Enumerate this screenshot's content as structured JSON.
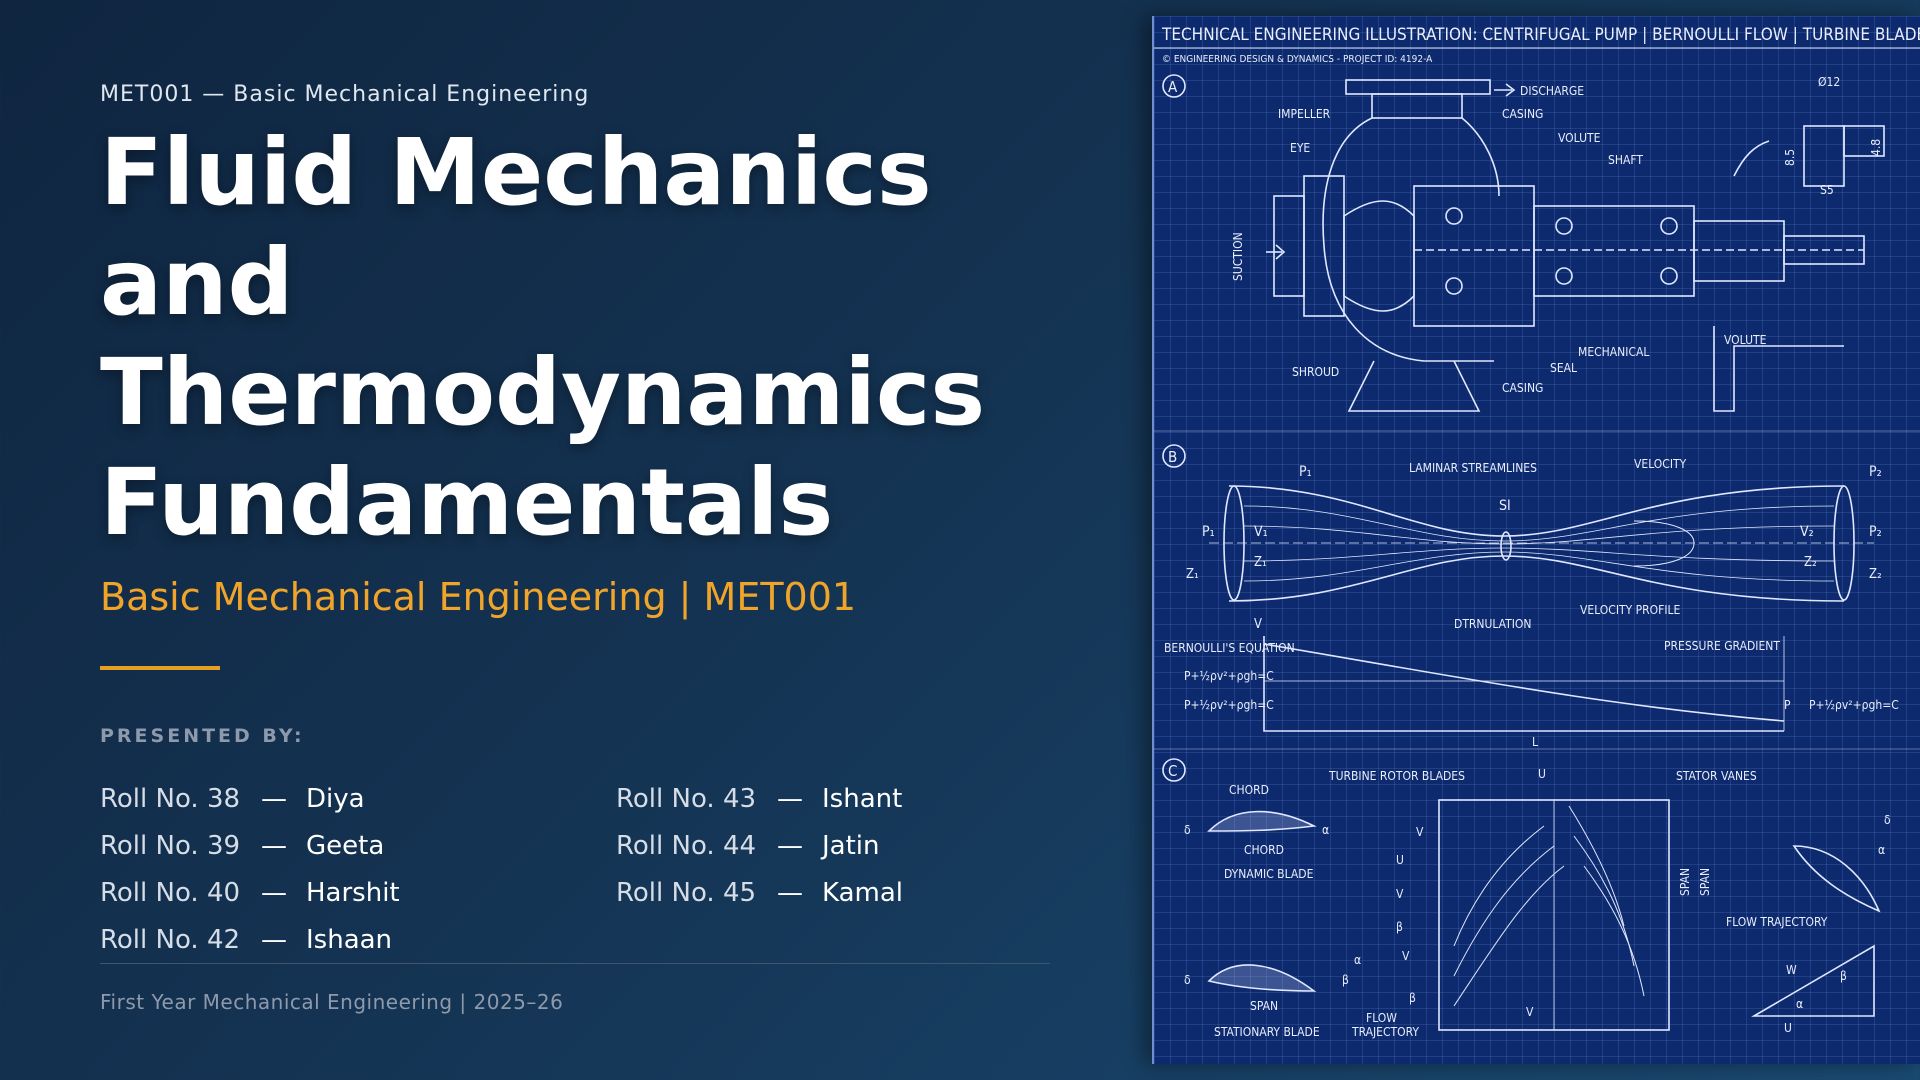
{
  "course_code_line": "MET001 — Basic Mechanical Engineering",
  "title_lines": [
    "Fluid Mechanics",
    "and",
    "Thermodynamics",
    "Fundamentals"
  ],
  "subtitle": "Basic Mechanical Engineering | MET001",
  "presented_by_label": "PRESENTED BY:",
  "members_col1": [
    {
      "roll": "Roll No. 38",
      "sep": "—",
      "name": "Diya"
    },
    {
      "roll": "Roll No. 39",
      "sep": "—",
      "name": "Geeta"
    },
    {
      "roll": "Roll No. 40",
      "sep": "—",
      "name": "Harshit"
    },
    {
      "roll": "Roll No. 42",
      "sep": "—",
      "name": "Ishaan"
    }
  ],
  "members_col2": [
    {
      "roll": "Roll No. 43",
      "sep": "—",
      "name": "Ishant"
    },
    {
      "roll": "Roll No. 44",
      "sep": "—",
      "name": "Jatin"
    },
    {
      "roll": "Roll No. 45",
      "sep": "—",
      "name": "Kamal"
    }
  ],
  "footer": "First Year Mechanical Engineering | 2025–26",
  "blueprint": {
    "header": "TECHNICAL ENGINEERING ILLUSTRATION: CENTRIFUGAL PUMP | BERNOULLI FLOW | TURBINE BLADES",
    "subheader": "© ENGINEERING DESIGN & DYNAMICS - PROJECT ID: 4192-A",
    "sections": [
      "A",
      "B",
      "C"
    ],
    "pump_labels": {
      "discharge": "DISCHARGE",
      "impeller": "IMPELLER",
      "casing_top": "CASING",
      "volute_top": "VOLUTE",
      "eye": "EYE",
      "shaft": "SHAFT",
      "suction": "SUCTION",
      "mechanical": "MECHANICAL",
      "seal": "SEAL",
      "volute_right": "VOLUTE",
      "shroud": "SHROUD",
      "casing_bottom": "CASING",
      "dim_top": "Ø12",
      "dim_left": "8.5",
      "dim_right": "4.8",
      "dim_bottom": "S5"
    },
    "flow_labels": {
      "p1": "P₁",
      "p2": "P₂",
      "laminar": "LAMINAR STREAMLINES",
      "velocity": "VELOCITY",
      "si": "SI",
      "p1_left": "P₁",
      "v1": "V₁",
      "z1a": "Z₁",
      "z1b": "Z₁",
      "v2": "V₂",
      "z2a": "Z₂",
      "p2_right": "P₂",
      "z2b": "Z₂",
      "velocity_profile": "VELOCITY PROFILE",
      "dtrnulation": "DTRNULATION",
      "v_axis": "V",
      "pressure_gradient": "PRESSURE GRADIENT",
      "bernoulli": "BERNOULLI'S EQUATION",
      "eq1": "P+½ρv²+ρgh=C",
      "eq2": "P+½ρv²+ρgh=C",
      "p_axis": "P",
      "eq3": "P+½ρv²+ρgh=C",
      "l_axis": "L"
    },
    "turbine_labels": {
      "chord_top": "CHORD",
      "chord": "CHORD",
      "dynamic_blade": "DYNAMIC BLADE",
      "alpha1": "α",
      "delta1": "δ",
      "rotor": "TURBINE ROTOR BLADES",
      "u_top": "U",
      "stator": "STATOR VANES",
      "v_in": "V",
      "u_side": "U",
      "v_side": "V",
      "beta_side": "β",
      "v_side2": "V",
      "beta_low": "β",
      "span1": "SPAN",
      "span2": "SPAN",
      "flow_trajectory": "FLOW TRAJECTORY",
      "delta2": "δ",
      "beta2": "β",
      "alpha2": "α",
      "span_bottom": "SPAN",
      "stationary_blade": "STATIONARY BLADE",
      "flow": "FLOW",
      "trajectory": "TRAJECTORY",
      "v_bottom": "V",
      "w": "W",
      "beta_tri": "β",
      "alpha_tri": "α",
      "u_tri": "U",
      "alpha_right": "α",
      "delta_right": "δ"
    }
  }
}
